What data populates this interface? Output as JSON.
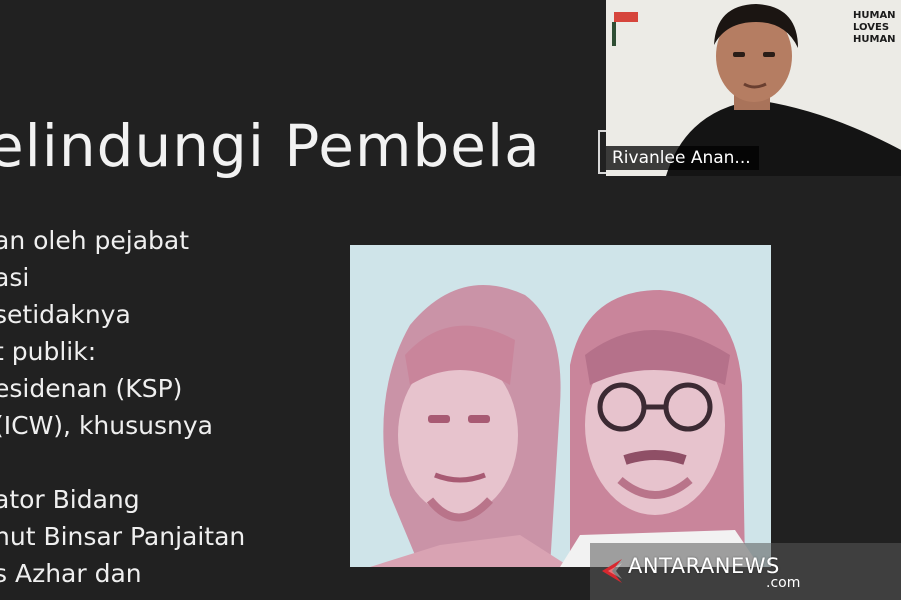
{
  "slide": {
    "title": "elindungi Pembela",
    "bullets": [
      "an oleh pejabat",
      "asi",
      "setidaknya",
      "t publik:",
      "esidenan (KSP)",
      "(ICW), khususnya",
      "",
      "ator Bidang",
      "hut Binsar Panjaitan",
      "s Azhar dan"
    ]
  },
  "video": {
    "participant_name": "Rivanlee Anan...",
    "poster_text": [
      "HUMAN",
      "LOVES",
      "HUMAN"
    ]
  },
  "watermark": {
    "brand": "ANTARANEWS",
    "domain": ".com"
  },
  "colors": {
    "slide_bg": "#212121",
    "photo_bg": "#cfe4e9",
    "photo_tint": "#c9859b",
    "watermark_red": "#d8282f"
  }
}
